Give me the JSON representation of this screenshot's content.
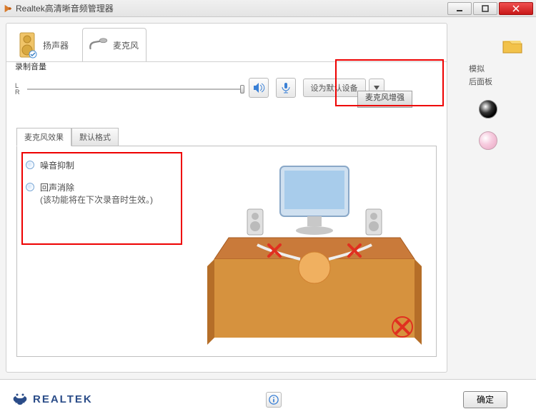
{
  "window": {
    "title": "Realtek高清晰音频管理器"
  },
  "winbuttons": {
    "min": "minimize",
    "max": "maximize",
    "close": "close"
  },
  "tabs": {
    "speaker": "扬声器",
    "microphone": "麦克风"
  },
  "volume": {
    "label": "录制音量",
    "lr_top": "L",
    "lr_bottom": "R",
    "default_button": "设为默认设备",
    "boost_button": "麦克风增强"
  },
  "subtabs": {
    "effects": "麦克风效果",
    "default_format": "默认格式"
  },
  "options": {
    "noise": "噪音抑制",
    "echo_title": "回声消除",
    "echo_note": "(该功能将在下次录音时生效。)"
  },
  "sidebar": {
    "section": "模拟",
    "rear_panel": "后面板"
  },
  "brand": {
    "name": "REALTEK"
  },
  "footer": {
    "ok": "确定"
  }
}
